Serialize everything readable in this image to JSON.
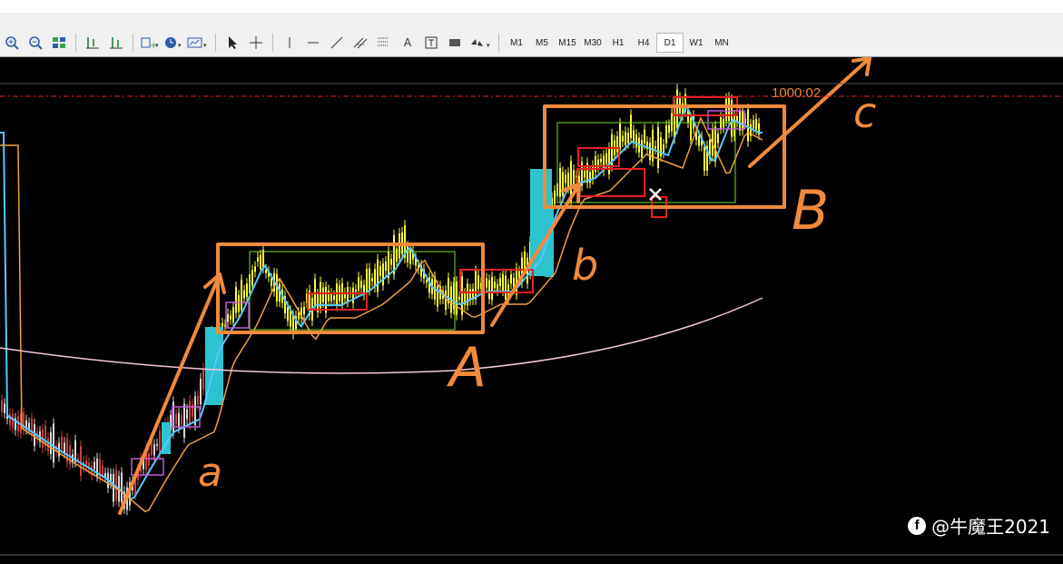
{
  "toolbar": {
    "icons": [
      "zoom-in-icon",
      "zoom-out-icon",
      "tile-windows-icon",
      "chart-shift-icon",
      "auto-scroll-icon",
      "indicators-icon",
      "periodicity-icon",
      "templates-icon",
      "cursor-icon",
      "crosshair-icon",
      "vertical-line-icon",
      "horizontal-line-icon",
      "trendline-icon",
      "channel-icon",
      "fibonacci-icon",
      "text-icon",
      "text-label-icon",
      "rectangle-icon",
      "arrows-icon"
    ],
    "text_tool": "A",
    "timeframes": [
      "M1",
      "M5",
      "M15",
      "M30",
      "H1",
      "H4",
      "D1",
      "W1",
      "MN"
    ],
    "active_timeframe": "D1"
  },
  "chart_data": {
    "type": "candlestick",
    "price_label": "1000:02",
    "annotations": [
      "a",
      "A",
      "b",
      "B",
      "c"
    ],
    "colors": {
      "background": "#000000",
      "annotation": "#f08a3c",
      "consolidation_box": "#7ddc1f",
      "red_box": "#e52020",
      "purple_box": "#c05ad8",
      "breakout_bar": "#2cc3cf",
      "candle": "#ffff33",
      "ma_fast": "#58c8ff",
      "ma_medium": "#f0a040",
      "ma_slow": "#f6c8d8"
    }
  },
  "watermark": {
    "text": "@牛魔王2021",
    "icon": "facebook-icon"
  }
}
